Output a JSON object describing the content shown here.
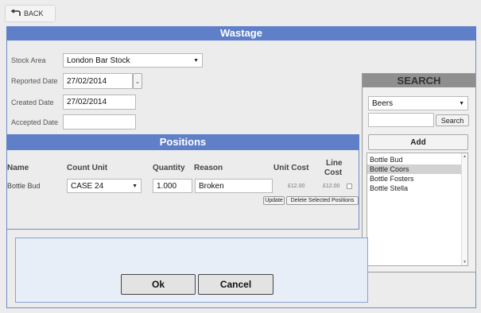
{
  "back": {
    "label": "BACK"
  },
  "wastage": {
    "title": "Wastage",
    "stock_area": {
      "label": "Stock Area",
      "value": "London Bar Stock"
    },
    "reported_date": {
      "label": "Reported Date",
      "value": "27/02/2014"
    },
    "created_date": {
      "label": "Created Date",
      "value": "27/02/2014"
    },
    "accepted_date": {
      "label": "Accepted Date",
      "value": ""
    }
  },
  "positions": {
    "title": "Positions",
    "headers": {
      "name": "Name",
      "count_unit": "Count Unit",
      "quantity": "Quantity",
      "reason": "Reason",
      "unit_cost": "Unit Cost",
      "line_cost_1": "Line",
      "line_cost_2": "Cost"
    },
    "rows": [
      {
        "name": "Bottle Bud",
        "count_unit": "CASE 24",
        "quantity": "1.000",
        "reason": "Broken",
        "unit_cost": "£12.00",
        "line_cost": "£12.00"
      }
    ],
    "update_label": "Update",
    "delete_label": "Delete Selected Positions"
  },
  "dialog": {
    "ok_label": "Ok",
    "cancel_label": "Cancel"
  },
  "search": {
    "title": "SEARCH",
    "category": "Beers",
    "query": "",
    "search_label": "Search",
    "add_label": "Add",
    "results": [
      {
        "label": "Bottle Bud",
        "selected": false
      },
      {
        "label": "Bottle Coors",
        "selected": true
      },
      {
        "label": "Bottle Fosters",
        "selected": false
      },
      {
        "label": "Bottle Stella",
        "selected": false
      }
    ]
  },
  "colors": {
    "header_blue": "#5f7fc8",
    "search_header_gray": "#8f8f8f",
    "selected_row": "#d2d2d2"
  }
}
